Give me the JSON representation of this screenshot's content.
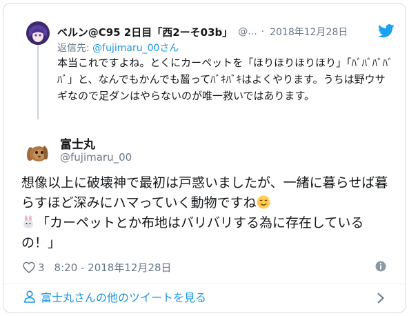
{
  "parent_tweet": {
    "display_name": "ベルン@C95 2日目「西2ーそ03b」",
    "handle": "@...",
    "separator": "·",
    "date": "2018年12月28日",
    "reply_prefix": "返信先: ",
    "reply_to": "@fujimaru_00さん",
    "text": "本当これですよね。とくにカーペットを「ほりほりほりほり」「ﾊﾞﾊﾞﾊﾞﾊﾞﾊﾞ」と、なんでもかんでも齧ってﾊﾞｷﾊﾞｷはよくやります。うちは野ウサギなので足ダンはやらないのが唯一救いではあります。"
  },
  "main_tweet": {
    "display_name": "富士丸",
    "handle": "@fujimaru_00",
    "text_line1": "想像以上に破壊神で最初は戸惑いましたが、一緒に暮らせば暮らすほど深みにハマっていく動物ですね",
    "text_line2": "「カーペットとか布地はバリバリする為に存在しているの！」",
    "like_count": "3",
    "timestamp": "8:20 - 2018年12月28日"
  },
  "footer": {
    "more_tweets_label": "富士丸さんの他のツイートを見る"
  },
  "colors": {
    "link": "#1b95e0",
    "secondary_text": "#657786",
    "border": "#d6dbe1",
    "twitter_blue": "#1da1f2"
  },
  "icons": [
    "twitter-bird-icon",
    "heart-icon",
    "info-icon",
    "person-icon",
    "chevron-right-icon",
    "smiling-face-emoji",
    "rabbit-face-emoji"
  ]
}
